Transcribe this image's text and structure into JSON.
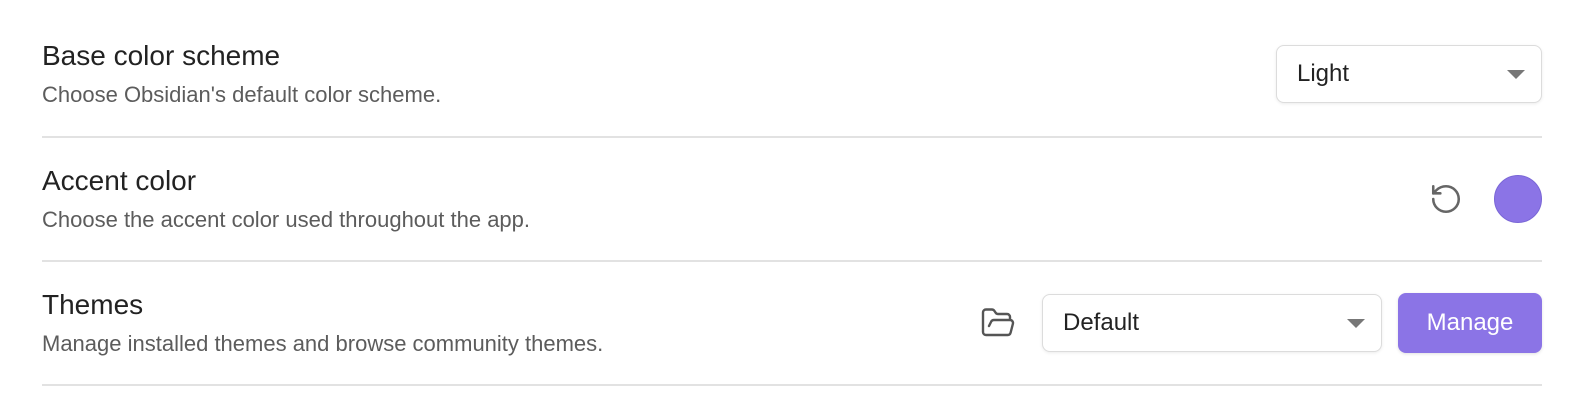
{
  "colors": {
    "accent": "#8b74e6",
    "divider": "#e2e2e2",
    "text_primary": "#222222",
    "text_muted": "#5c5c5c"
  },
  "settings": [
    {
      "name": "Base color scheme",
      "description": "Choose Obsidian's default color scheme.",
      "control": {
        "type": "dropdown",
        "selected": "Light"
      }
    },
    {
      "name": "Accent color",
      "description": "Choose the accent color used throughout the app.",
      "control": {
        "type": "color-picker",
        "reset_icon": "reset-icon",
        "swatch_color": "#8b74e6"
      }
    },
    {
      "name": "Themes",
      "description": "Manage installed themes and browse community themes.",
      "control": {
        "type": "dropdown-with-actions",
        "folder_icon": "folder-open-icon",
        "selected": "Default",
        "button_label": "Manage"
      }
    }
  ]
}
